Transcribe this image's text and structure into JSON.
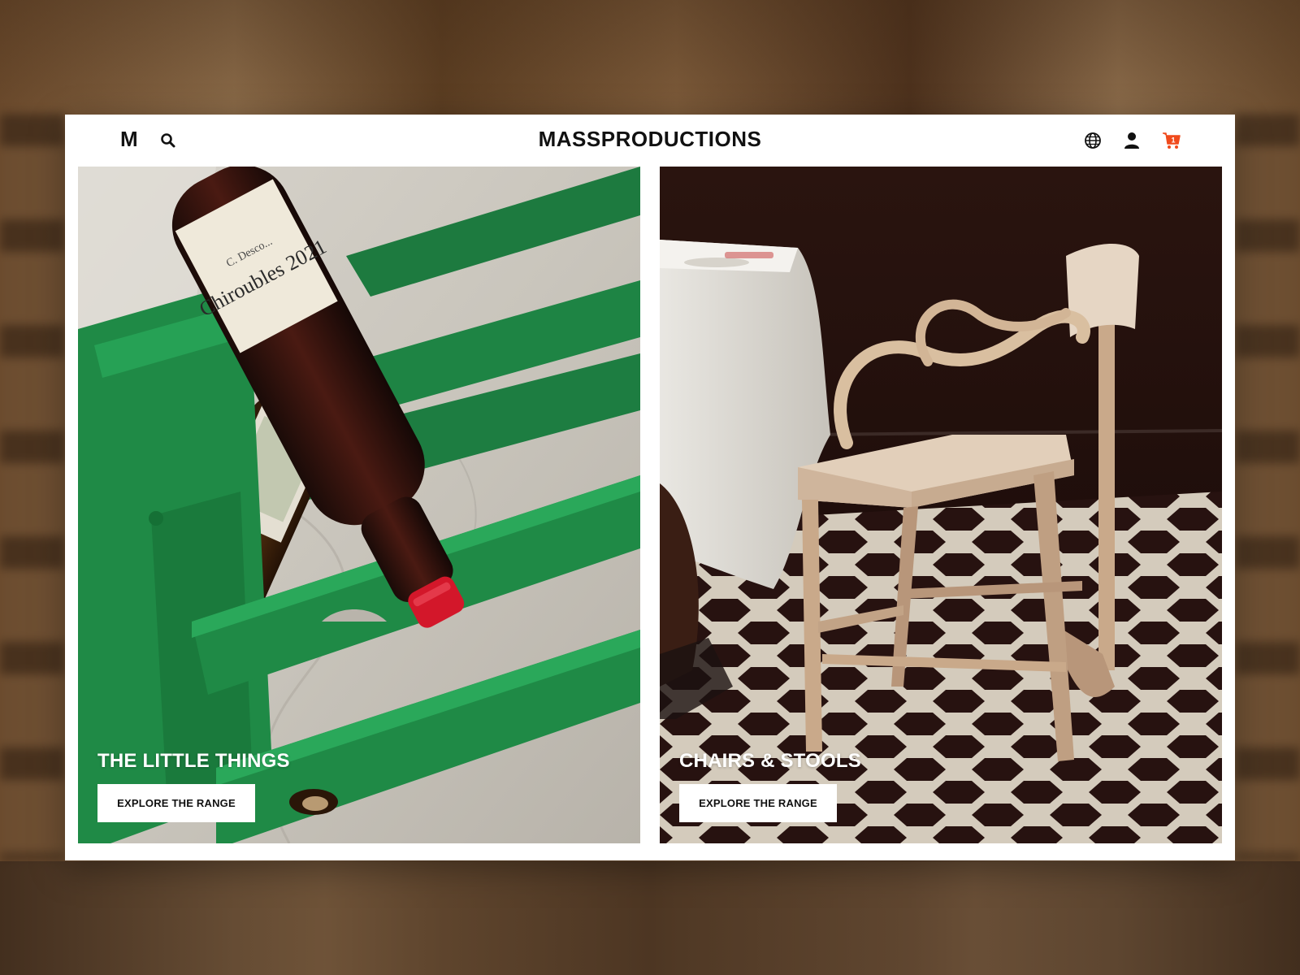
{
  "header": {
    "logo_mark": "M",
    "brand_name": "MASSPRODUCTIONS",
    "cart_count": "1"
  },
  "panels": [
    {
      "title": "THE LITTLE THINGS",
      "cta_label": "EXPLORE THE RANGE"
    },
    {
      "title": "CHAIRS & STOOLS",
      "cta_label": "EXPLORE THE RANGE"
    }
  ],
  "label_text": {
    "wine_line_1": "Chiroubles 2021",
    "wine_line_2": "C. Desco..."
  },
  "colors": {
    "rack_green": "#1f8a46",
    "cap_red": "#d3172a",
    "cart_accent": "#f04a1c",
    "wood": "#d9bfa0",
    "tile_dark": "#2b1412"
  }
}
